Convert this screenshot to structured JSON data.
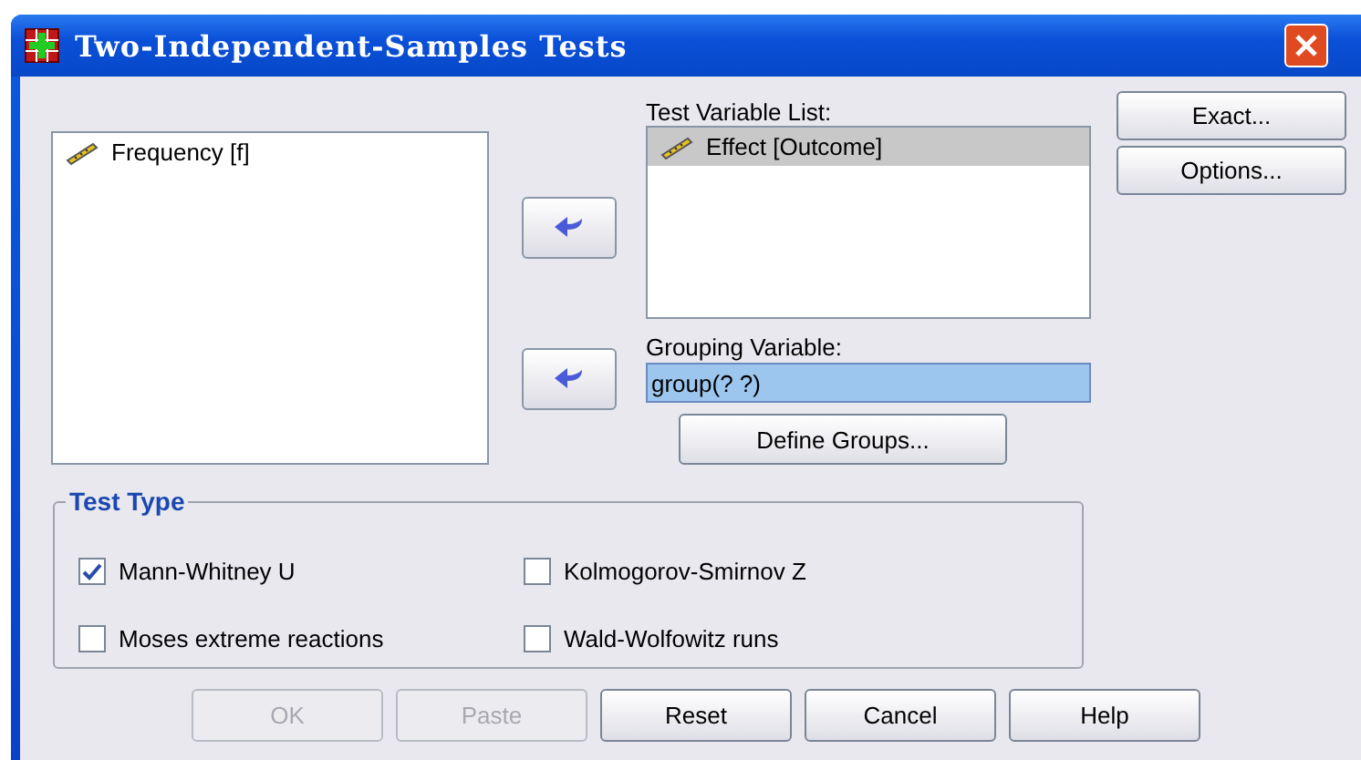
{
  "window": {
    "title": "Two-Independent-Samples Tests"
  },
  "source_list": {
    "items": [
      {
        "label": "Frequency [f]",
        "selected": false
      }
    ]
  },
  "move_buttons": [
    {
      "kind": "arrow"
    },
    {
      "kind": "arrow"
    }
  ],
  "test_variable_list": {
    "label": "Test Variable List:",
    "items": [
      {
        "label": "Effect [Outcome]",
        "selected": true
      }
    ]
  },
  "grouping_variable": {
    "label": "Grouping Variable:",
    "value": "group(? ?)"
  },
  "define_groups_button": "Define Groups...",
  "side_buttons": [
    "Exact...",
    "Options..."
  ],
  "test_type": {
    "title": "Test Type",
    "options": [
      {
        "label": "Mann-Whitney U",
        "checked": true
      },
      {
        "label": "Kolmogorov-Smirnov Z",
        "checked": false
      },
      {
        "label": "Moses extreme reactions",
        "checked": false
      },
      {
        "label": "Wald-Wolfowitz runs",
        "checked": false
      }
    ]
  },
  "buttons": [
    {
      "label": "OK",
      "disabled": true
    },
    {
      "label": "Paste",
      "disabled": true
    },
    {
      "label": "Reset",
      "disabled": false
    },
    {
      "label": "Cancel",
      "disabled": false
    },
    {
      "label": "Help",
      "disabled": false
    }
  ]
}
